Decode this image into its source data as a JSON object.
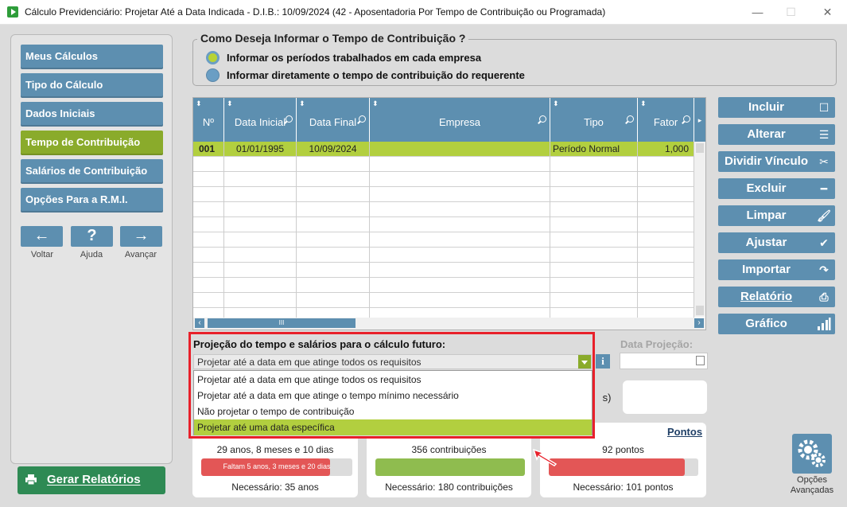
{
  "window": {
    "title": "Cálculo Previdenciário: Projetar Até a Data Indicada - D.I.B.: 10/09/2024 (42 - Aposentadoria Por Tempo de Contribuição ou Programada)",
    "min_glyph": "—",
    "max_glyph": "☐",
    "close_glyph": "✕"
  },
  "sidebar": {
    "items": [
      {
        "label": "Meus Cálculos"
      },
      {
        "label": "Tipo do Cálculo"
      },
      {
        "label": "Dados Iniciais"
      },
      {
        "label": "Tempo de Contribuição",
        "active": true
      },
      {
        "label": "Salários de Contribuição"
      },
      {
        "label": "Opções Para a R.M.I."
      }
    ],
    "nav": {
      "back_glyph": "←",
      "back_label": "Voltar",
      "help_glyph": "?",
      "help_label": "Ajuda",
      "forward_glyph": "→",
      "forward_label": "Avançar"
    },
    "report_button": "Gerar Relatórios"
  },
  "contribution": {
    "legend": "Como Deseja Informar o Tempo de Contribuição ?",
    "options": [
      {
        "label": "Informar os períodos trabalhados em cada empresa",
        "selected": true
      },
      {
        "label": "Informar diretamente o tempo de contribuição do requerente",
        "selected": false
      }
    ]
  },
  "grid": {
    "columns": [
      "Nº",
      "Data Inicial",
      "Data Final",
      "Empresa",
      "Tipo",
      "Fator"
    ],
    "rows": [
      {
        "num": "001",
        "start": "01/01/1995",
        "end": "10/09/2024",
        "company": "",
        "type": "Período Normal",
        "factor": "1,000"
      }
    ],
    "scroll_glyph": "III",
    "left_glyph": "‹",
    "right_glyph": "›"
  },
  "actions": {
    "buttons": [
      {
        "label": "Incluir",
        "icon": "square-icon",
        "glyph": "☐"
      },
      {
        "label": "Alterar",
        "icon": "list-edit-icon",
        "glyph": "☰"
      },
      {
        "label": "Dividir Vínculo",
        "icon": "scissors-icon",
        "glyph": "✂"
      },
      {
        "label": "Excluir",
        "icon": "minus-icon",
        "glyph": "━"
      },
      {
        "label": "Limpar",
        "icon": "brush-icon",
        "glyph": "🖌"
      },
      {
        "label": "Ajustar",
        "icon": "check-icon",
        "glyph": "✔"
      },
      {
        "label": "Importar",
        "icon": "import-arrow-icon",
        "glyph": "↷"
      },
      {
        "label": "Relatório",
        "icon": "printer-icon",
        "glyph": "⎙"
      },
      {
        "label": "Gráfico",
        "icon": "bar-chart-icon",
        "glyph": "▮"
      }
    ]
  },
  "projection": {
    "title": "Projeção do tempo e salários para o cálculo futuro:",
    "selected": "Projetar até a data em que atinge todos os requisitos",
    "options": [
      "Projetar até a data em que atinge todos os requisitos",
      "Projetar até a data em que atinge o tempo mínimo necessário",
      "Não projetar o tempo de contribuição",
      "Projetar até uma data específica"
    ],
    "highlighted_index": 3,
    "info_glyph": "i",
    "date_label": "Data Projeção:",
    "date_value": ""
  },
  "summary": {
    "partial_glyph": "s)",
    "pontos_title": "Pontos",
    "tempo": {
      "value": "29 anos, 8 meses e 10 dias",
      "bar_text": "Faltam 5 anos, 3 meses e 20 dias",
      "progress": 0.85,
      "color": "#e35656",
      "needed": "Necessário: 35 anos"
    },
    "carencia": {
      "value": "356 contribuições",
      "progress": 1.0,
      "color": "#8fbc4f",
      "needed": "Necessário: 180 contribuições"
    },
    "pontos": {
      "value": "92 pontos",
      "progress": 0.91,
      "color": "#e35656",
      "needed": "Necessário: 101 pontos"
    }
  },
  "advanced": {
    "label_line1": "Opções",
    "label_line2": "Avançadas"
  }
}
